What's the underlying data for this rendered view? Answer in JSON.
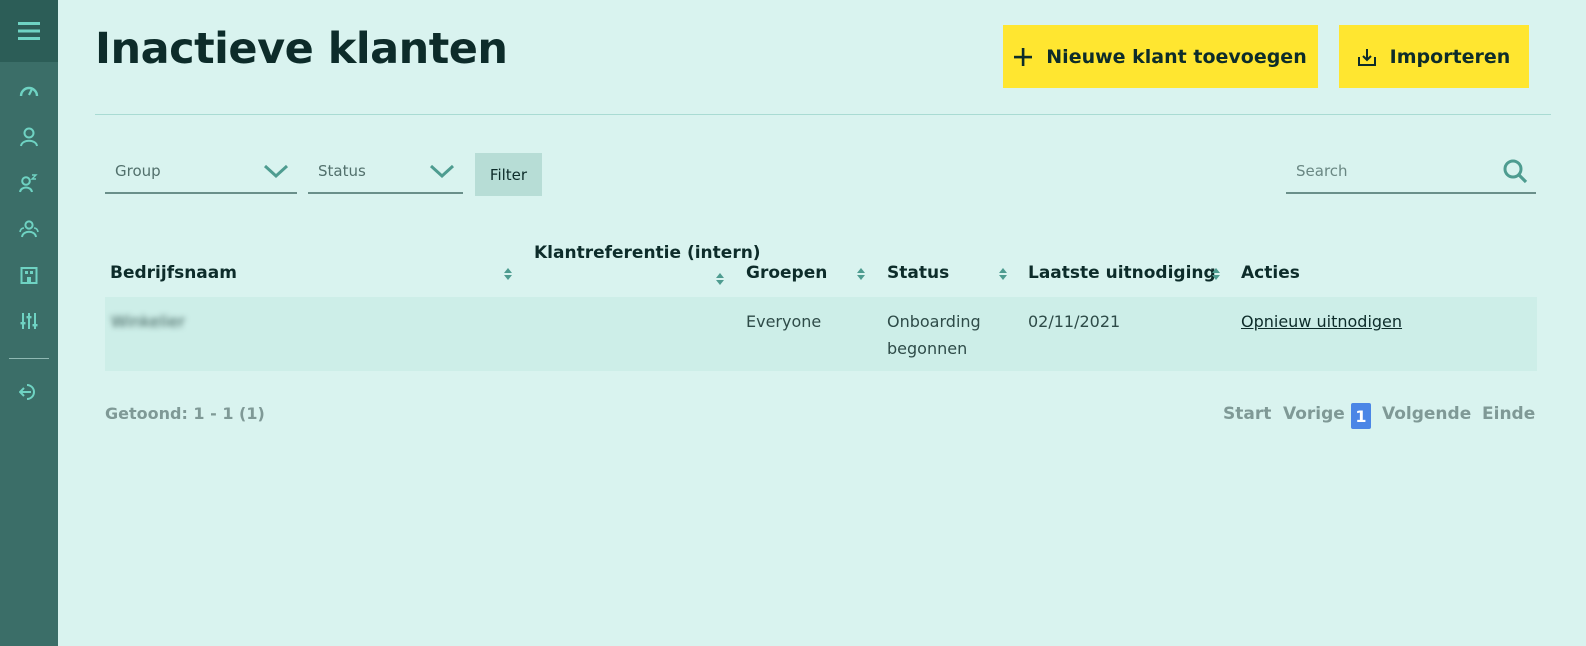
{
  "sidebar": {
    "menu_icon": "hamburger-icon",
    "items": [
      {
        "icon": "dashboard-icon"
      },
      {
        "icon": "user-icon"
      },
      {
        "icon": "user-sleep-icon"
      },
      {
        "icon": "users-group-icon"
      },
      {
        "icon": "building-icon"
      },
      {
        "icon": "sliders-icon"
      }
    ],
    "logout_icon": "logout-icon"
  },
  "header": {
    "title": "Inactieve klanten",
    "add_button": "Nieuwe klant toevoegen",
    "import_button": "Importeren"
  },
  "filters": {
    "group_label": "Group",
    "status_label": "Status",
    "filter_button": "Filter",
    "search_placeholder": "Search"
  },
  "table": {
    "columns": [
      "Bedrijfsnaam",
      "Klantreferentie (intern)",
      "Groepen",
      "Status",
      "Laatste uitnodiging",
      "Acties"
    ],
    "rows": [
      {
        "company": "Winkelier",
        "reference": "",
        "groups": "Everyone",
        "status_line1": "Onboarding",
        "status_line2": "begonnen",
        "last_invite": "02/11/2021",
        "action": "Opnieuw uitnodigen"
      }
    ]
  },
  "pagination": {
    "shown": "Getoond: 1 - 1 (1)",
    "start": "Start",
    "prev": "Vorige",
    "current": "1",
    "next": "Volgende",
    "end": "Einde"
  },
  "colors": {
    "background": "#d9f3ef",
    "sidebar": "#3b6e68",
    "accent_yellow": "#ffe630",
    "teal_icon": "#6fd3c3",
    "current_page": "#4b86e6"
  }
}
